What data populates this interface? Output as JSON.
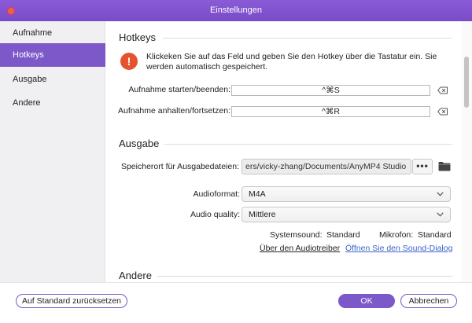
{
  "window": {
    "title": "Einstellungen"
  },
  "sidebar": {
    "items": [
      {
        "label": "Aufnahme",
        "active": false
      },
      {
        "label": "Hotkeys",
        "active": true
      },
      {
        "label": "Ausgabe",
        "active": false
      },
      {
        "label": "Andere",
        "active": false
      }
    ]
  },
  "hotkeys": {
    "title": "Hotkeys",
    "notice": "Klickeken Sie auf das Feld und geben Sie den Hotkey über die Tastatur ein. Sie werden automatisch gespeichert.",
    "rows": [
      {
        "label": "Aufnahme starten/beenden:",
        "value": "^⌘S"
      },
      {
        "label": "Aufnahme anhalten/fortsetzen:",
        "value": "^⌘R"
      }
    ]
  },
  "ausgabe": {
    "title": "Ausgabe",
    "path_label": "Speicherort für Ausgabedateien:",
    "path_value": "ers/vicky-zhang/Documents/AnyMP4 Studio",
    "browse_label": "•••",
    "audioformat_label": "Audioformat:",
    "audioformat_value": "M4A",
    "quality_label": "Audio quality:",
    "quality_value": "Mittlere",
    "systemsound_label": "Systemsound:",
    "systemsound_value": "Standard",
    "mikrofon_label": "Mikrofon:",
    "mikrofon_value": "Standard",
    "link_driver": "Über den Audiotreiber",
    "link_sound": "Öffnen Sie den Sound-Dialog"
  },
  "andere": {
    "title": "Andere"
  },
  "footer": {
    "reset_label": "Auf Standard zurücksetzen",
    "ok_label": "OK",
    "cancel_label": "Abbrechen"
  },
  "colors": {
    "accent": "#7d58c9",
    "warning": "#e4532f",
    "link_driver": "#222222",
    "link_sound": "#3a64c8"
  }
}
